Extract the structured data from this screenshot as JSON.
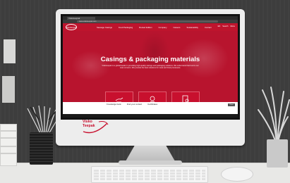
{
  "browser": {
    "tab_title": "Viskoteepak",
    "url": "www.viskoteepak.com"
  },
  "site": {
    "logo_text": "Viskoteepak",
    "nav_items": [
      "Sausage Casings",
      "Food Packaging",
      "Rooted Edition",
      "Company",
      "Careers",
      "Sustainability",
      "Contact"
    ],
    "top_right_items": [
      "EN",
      "Search",
      "Menu"
    ],
    "hero_headline": "Casings & packaging materials",
    "hero_subtext": "Viskoteepak is a global leader in providing high-quality casings and packaging solutions. We understand that food is our main concern. We provide the best solutions for meat and food processors.",
    "cards": [
      {
        "icon": "hand-sausage-icon"
      },
      {
        "icon": "person-headset-icon"
      },
      {
        "icon": "document-certificate-icon"
      }
    ],
    "bottom_links": [
      "Knowledge bank",
      "Find your contact",
      "Certificates"
    ],
    "corner_button": "Close"
  },
  "monitor_brand": {
    "line1": "Visko",
    "line2": "Teepak"
  },
  "colors": {
    "brand_red": "#c8102e",
    "wall": "#3d3d3d",
    "desk": "#e8e8e6"
  }
}
